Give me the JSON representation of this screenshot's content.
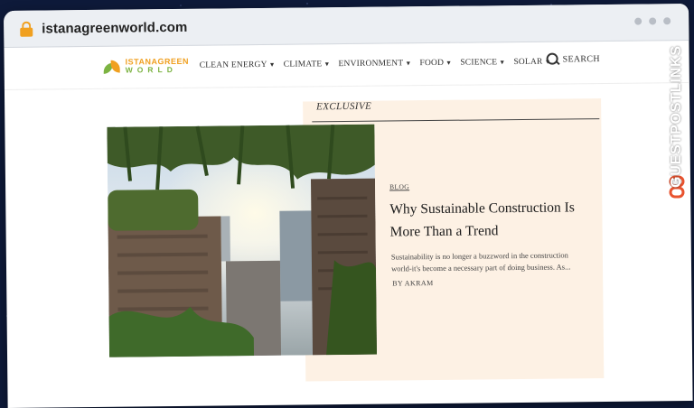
{
  "browser": {
    "url": "istanagreenworld.com"
  },
  "site": {
    "logo_top": "ISTANAGREEN",
    "logo_bottom": "WORLD",
    "nav": [
      {
        "label": "CLEAN ENERGY"
      },
      {
        "label": "CLIMATE"
      },
      {
        "label": "ENVIRONMENT"
      },
      {
        "label": "FOOD"
      },
      {
        "label": "SCIENCE"
      },
      {
        "label": "SOLAR"
      }
    ],
    "search_label": "SEARCH"
  },
  "feature": {
    "section": "EXCLUSIVE",
    "tag": "BLOG",
    "headline": "Why Sustainable Construction Is More Than a Trend",
    "excerpt": "Sustainability is no longer a buzzword in the construction world-it's become a necessary part of doing business. As...",
    "byline": "BY AKRAM"
  },
  "watermark": {
    "text": "GUESTPOSTLINKS"
  },
  "colors": {
    "accent_orange": "#f0a020",
    "accent_green": "#7cb342",
    "card_bg": "#fdf1e4",
    "page_bg": "#0e1a3a"
  }
}
